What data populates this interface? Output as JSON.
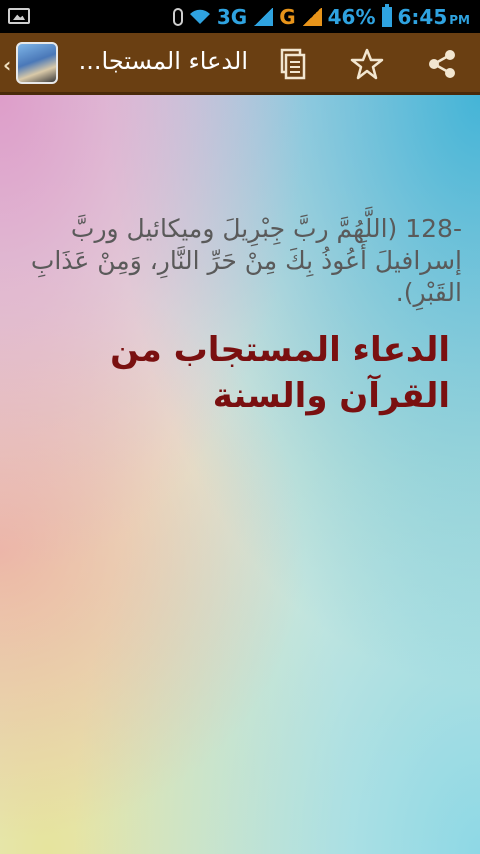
{
  "status_bar": {
    "network_3g": "3G",
    "network_g": "G",
    "battery": "46%",
    "time": "6:45",
    "time_suffix": "PM",
    "color": "#2fa3e0"
  },
  "action_bar": {
    "title": "الدعاء المستجا...",
    "background": "#6a3f12",
    "icons": [
      "app-icon",
      "copy-icon",
      "star-icon",
      "share-icon"
    ]
  },
  "content": {
    "number": "128-",
    "dua": "(اللَّهُمَّ ربَّ جِبْرِيلَ وميكائيل وربَّ إسرافيلَ أَعُوذُ بِكَ مِنْ حَرِّ النَّارِ، وَمِنْ عَذَابِ القَبْرِ).",
    "heading": "الدعاء المستجاب من القرآن والسنة",
    "heading_color": "#7a1010"
  }
}
